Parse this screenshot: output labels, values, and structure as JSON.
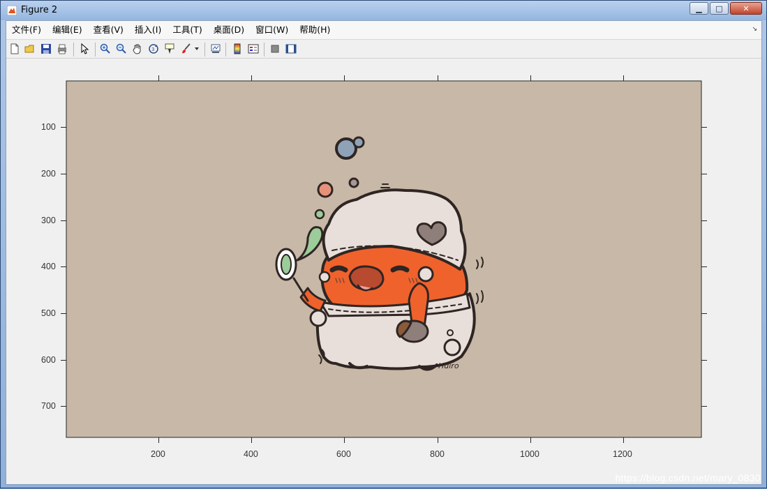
{
  "window": {
    "title": "Figure 2"
  },
  "menu": [
    {
      "label": "文件(F)"
    },
    {
      "label": "编辑(E)"
    },
    {
      "label": "查看(V)"
    },
    {
      "label": "插入(I)"
    },
    {
      "label": "工具(T)"
    },
    {
      "label": "桌面(D)"
    },
    {
      "label": "窗口(W)"
    },
    {
      "label": "帮助(H)"
    }
  ],
  "toolbar": [
    "new-figure-icon",
    "open-file-icon",
    "save-icon",
    "print-icon",
    "pointer-icon",
    "zoom-in-icon",
    "zoom-out-icon",
    "pan-icon",
    "rotate-3d-icon",
    "data-cursor-icon",
    "brush-icon",
    "link-plot-icon",
    "colorbar-icon",
    "legend-icon",
    "hide-plot-tools-icon",
    "show-plot-tools-icon"
  ],
  "axes": {
    "x_ticks": [
      "200",
      "400",
      "600",
      "800",
      "1000",
      "1200"
    ],
    "y_ticks": [
      "100",
      "200",
      "300",
      "400",
      "500",
      "600",
      "700"
    ]
  },
  "image": {
    "background": "#c8b8a8",
    "description_colors": {
      "body": "#f0622c",
      "hat": "#e8dfdb",
      "outline": "#2f2522"
    },
    "signature": "Huiro"
  },
  "watermark": "https://blog.csdn.net/mary_0830"
}
